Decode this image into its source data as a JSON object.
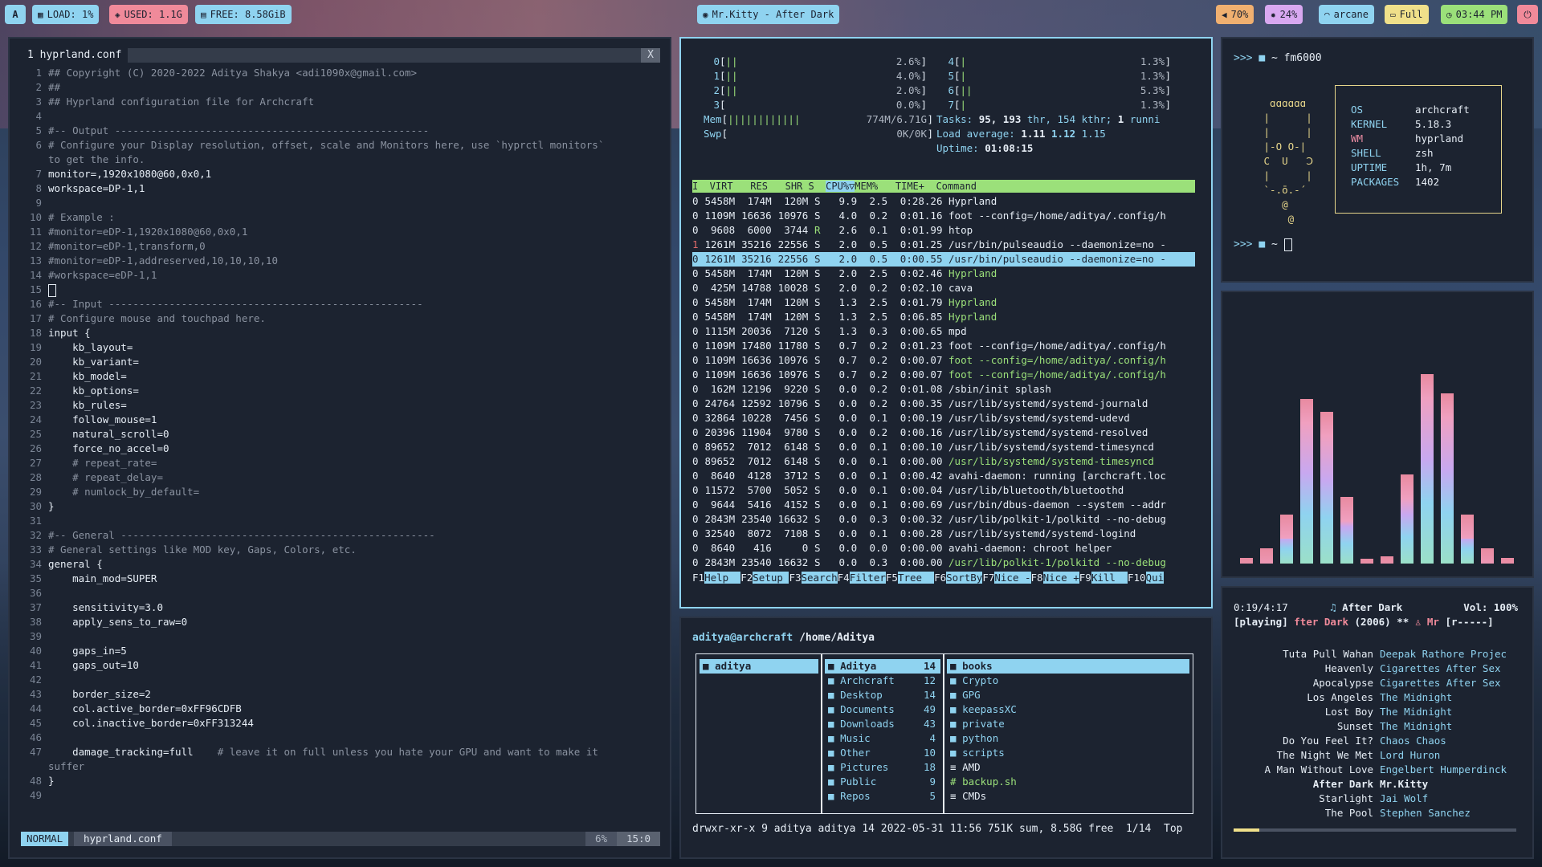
{
  "topbar": {
    "logo": "A",
    "load": "LOAD: 1%",
    "used": "USED: 1.1G",
    "free": "FREE: 8.58GiB",
    "window_title": "Mr.Kitty - After Dark",
    "volume": "70%",
    "brightness": "24%",
    "wifi": "arcane",
    "battery": "Full",
    "clock": "03:44 PM",
    "colors": {
      "load": "#8fd3f0",
      "used": "#f08a9a",
      "free": "#8fd3f0",
      "title": "#8fd3f0",
      "volume": "#f0b070",
      "brightness": "#d8a8f0",
      "wifi": "#8fd3f0",
      "battery": "#f0e08a",
      "clock": "#9be07a",
      "power": "#f08a9a"
    }
  },
  "editor": {
    "tab_title": "1 hyprland.conf",
    "tab_close": "X",
    "lines": [
      {
        "n": "1",
        "t": "## Copyright (C) 2020-2022 Aditya Shakya <adi1090x@gmail.com>",
        "c": true
      },
      {
        "n": "2",
        "t": "##",
        "c": true
      },
      {
        "n": "3",
        "t": "## Hyprland configuration file for Archcraft",
        "c": true
      },
      {
        "n": "4",
        "t": "",
        "c": false
      },
      {
        "n": "5",
        "t": "#-- Output ----------------------------------------------------",
        "c": true
      },
      {
        "n": "6",
        "t": "# Configure your Display resolution, offset, scale and Monitors here, use `hyprctl monitors`",
        "c": true
      },
      {
        "n": "",
        "t": "to get the info.",
        "c": true,
        "wrap": true
      },
      {
        "n": "7",
        "t": "monitor=,1920x1080@60,0x0,1",
        "c": false
      },
      {
        "n": "8",
        "t": "workspace=DP-1,1",
        "c": false
      },
      {
        "n": "9",
        "t": "",
        "c": false
      },
      {
        "n": "10",
        "t": "# Example :",
        "c": true
      },
      {
        "n": "11",
        "t": "#monitor=eDP-1,1920x1080@60,0x0,1",
        "c": true
      },
      {
        "n": "12",
        "t": "#monitor=eDP-1,transform,0",
        "c": true
      },
      {
        "n": "13",
        "t": "#monitor=eDP-1,addreserved,10,10,10,10",
        "c": true
      },
      {
        "n": "14",
        "t": "#workspace=eDP-1,1",
        "c": true
      },
      {
        "n": "15",
        "t": "",
        "c": false,
        "cursor": true
      },
      {
        "n": "16",
        "t": "#-- Input ----------------------------------------------------",
        "c": true
      },
      {
        "n": "17",
        "t": "# Configure mouse and touchpad here.",
        "c": true
      },
      {
        "n": "18",
        "t": "input {",
        "c": false
      },
      {
        "n": "19",
        "t": "    kb_layout=",
        "c": false
      },
      {
        "n": "20",
        "t": "    kb_variant=",
        "c": false
      },
      {
        "n": "21",
        "t": "    kb_model=",
        "c": false
      },
      {
        "n": "22",
        "t": "    kb_options=",
        "c": false
      },
      {
        "n": "23",
        "t": "    kb_rules=",
        "c": false
      },
      {
        "n": "24",
        "t": "    follow_mouse=1",
        "c": false
      },
      {
        "n": "25",
        "t": "    natural_scroll=0",
        "c": false
      },
      {
        "n": "26",
        "t": "    force_no_accel=0",
        "c": false
      },
      {
        "n": "27",
        "t": "    # repeat_rate=",
        "c": true
      },
      {
        "n": "28",
        "t": "    # repeat_delay=",
        "c": true
      },
      {
        "n": "29",
        "t": "    # numlock_by_default=",
        "c": true
      },
      {
        "n": "30",
        "t": "}",
        "c": false
      },
      {
        "n": "31",
        "t": "",
        "c": false
      },
      {
        "n": "32",
        "t": "#-- General ----------------------------------------------------",
        "c": true
      },
      {
        "n": "33",
        "t": "# General settings like MOD key, Gaps, Colors, etc.",
        "c": true
      },
      {
        "n": "34",
        "t": "general {",
        "c": false
      },
      {
        "n": "35",
        "t": "    main_mod=SUPER",
        "c": false
      },
      {
        "n": "36",
        "t": "",
        "c": false
      },
      {
        "n": "37",
        "t": "    sensitivity=3.0",
        "c": false
      },
      {
        "n": "38",
        "t": "    apply_sens_to_raw=0",
        "c": false
      },
      {
        "n": "39",
        "t": "",
        "c": false
      },
      {
        "n": "40",
        "t": "    gaps_in=5",
        "c": false
      },
      {
        "n": "41",
        "t": "    gaps_out=10",
        "c": false
      },
      {
        "n": "42",
        "t": "",
        "c": false
      },
      {
        "n": "43",
        "t": "    border_size=2",
        "c": false
      },
      {
        "n": "44",
        "t": "    col.active_border=0xFF96CDFB",
        "c": false
      },
      {
        "n": "45",
        "t": "    col.inactive_border=0xFF313244",
        "c": false
      },
      {
        "n": "46",
        "t": "",
        "c": false
      },
      {
        "n": "47",
        "t": "    damage_tracking=full",
        "c": false,
        "trail": "    # leave it on full unless you hate your GPU and want to make it"
      },
      {
        "n": "",
        "t": "suffer",
        "c": true,
        "wrap": true
      },
      {
        "n": "48",
        "t": "}",
        "c": false
      },
      {
        "n": "49",
        "t": "",
        "c": false
      }
    ],
    "status": {
      "mode": "NORMAL",
      "file": "hyprland.conf",
      "percent": "6%",
      "position": "15:0"
    }
  },
  "htop": {
    "cpus": [
      {
        "id": "0",
        "bar": "||",
        "pct": "2.6%"
      },
      {
        "id": "1",
        "bar": "||",
        "pct": "4.0%"
      },
      {
        "id": "2",
        "bar": "||",
        "pct": "2.0%"
      },
      {
        "id": "3",
        "bar": "",
        "pct": "0.0%"
      },
      {
        "id": "4",
        "bar": "|",
        "pct": "1.3%"
      },
      {
        "id": "5",
        "bar": "|",
        "pct": "1.3%"
      },
      {
        "id": "6",
        "bar": "||",
        "pct": "5.3%"
      },
      {
        "id": "7",
        "bar": "|",
        "pct": "1.3%"
      }
    ],
    "mem": {
      "label": "Mem",
      "bar": "||||||||||||",
      "value": "774M/6.71G"
    },
    "swp": {
      "label": "Swp",
      "value": "0K/0K"
    },
    "tasks": {
      "label": "Tasks:",
      "tasks": "95,",
      "thr": "193",
      "thr_label": "thr, 154 kthr;",
      "running": "1",
      "running_label": "runni"
    },
    "load": {
      "label": "Load average:",
      "a": "1.11",
      "b": "1.12",
      "c": "1.15"
    },
    "uptime": {
      "label": "Uptime:",
      "value": "01:08:15"
    },
    "header": {
      "pre": "I  VIRT   RES   SHR S  ",
      "sort": "CPU%▽",
      "post": "MEM%   TIME+  Command"
    },
    "processes": [
      {
        "p": "0",
        "virt": "5458M",
        "res": "174M",
        "shr": "120M",
        "s": "S",
        "cpu": "9.9",
        "mem": "2.5",
        "time": "0:28.26",
        "cmd": "Hyprland",
        "thr": false
      },
      {
        "p": "0",
        "virt": "1109M",
        "res": "16636",
        "shr": "10976",
        "s": "S",
        "cpu": "4.0",
        "mem": "0.2",
        "time": "0:01.16",
        "cmd": "foot --config=/home/aditya/.config/h",
        "thr": false
      },
      {
        "p": "0",
        "virt": "9608",
        "res": "6000",
        "shr": "3744",
        "s": "R",
        "cpu": "2.6",
        "mem": "0.1",
        "time": "0:01.99",
        "cmd": "htop",
        "thr": false
      },
      {
        "p": "1",
        "virt": "1261M",
        "res": "35216",
        "shr": "22556",
        "s": "S",
        "cpu": "2.0",
        "mem": "0.5",
        "time": "0:01.25",
        "cmd": "/usr/bin/pulseaudio --daemonize=no -",
        "thr": false,
        "red": true
      },
      {
        "p": "0",
        "virt": "1261M",
        "res": "35216",
        "shr": "22556",
        "s": "S",
        "cpu": "2.0",
        "mem": "0.5",
        "time": "0:00.55",
        "cmd": "/usr/bin/pulseaudio --daemonize=no -",
        "thr": false,
        "sel": true
      },
      {
        "p": "0",
        "virt": "5458M",
        "res": "174M",
        "shr": "120M",
        "s": "S",
        "cpu": "2.0",
        "mem": "2.5",
        "time": "0:02.46",
        "cmd": "Hyprland",
        "thr": true
      },
      {
        "p": "0",
        "virt": "425M",
        "res": "14788",
        "shr": "10028",
        "s": "S",
        "cpu": "2.0",
        "mem": "0.2",
        "time": "0:02.10",
        "cmd": "cava",
        "thr": false
      },
      {
        "p": "0",
        "virt": "5458M",
        "res": "174M",
        "shr": "120M",
        "s": "S",
        "cpu": "1.3",
        "mem": "2.5",
        "time": "0:01.79",
        "cmd": "Hyprland",
        "thr": true
      },
      {
        "p": "0",
        "virt": "5458M",
        "res": "174M",
        "shr": "120M",
        "s": "S",
        "cpu": "1.3",
        "mem": "2.5",
        "time": "0:06.85",
        "cmd": "Hyprland",
        "thr": true
      },
      {
        "p": "0",
        "virt": "1115M",
        "res": "20036",
        "shr": "7120",
        "s": "S",
        "cpu": "1.3",
        "mem": "0.3",
        "time": "0:00.65",
        "cmd": "mpd",
        "thr": false
      },
      {
        "p": "0",
        "virt": "1109M",
        "res": "17480",
        "shr": "11780",
        "s": "S",
        "cpu": "0.7",
        "mem": "0.2",
        "time": "0:01.23",
        "cmd": "foot --config=/home/aditya/.config/h",
        "thr": false
      },
      {
        "p": "0",
        "virt": "1109M",
        "res": "16636",
        "shr": "10976",
        "s": "S",
        "cpu": "0.7",
        "mem": "0.2",
        "time": "0:00.07",
        "cmd": "foot --config=/home/aditya/.config/h",
        "thr": true
      },
      {
        "p": "0",
        "virt": "1109M",
        "res": "16636",
        "shr": "10976",
        "s": "S",
        "cpu": "0.7",
        "mem": "0.2",
        "time": "0:00.07",
        "cmd": "foot --config=/home/aditya/.config/h",
        "thr": true
      },
      {
        "p": "0",
        "virt": "162M",
        "res": "12196",
        "shr": "9220",
        "s": "S",
        "cpu": "0.0",
        "mem": "0.2",
        "time": "0:01.08",
        "cmd": "/sbin/init splash",
        "thr": false
      },
      {
        "p": "0",
        "virt": "24764",
        "res": "12592",
        "shr": "10796",
        "s": "S",
        "cpu": "0.0",
        "mem": "0.2",
        "time": "0:00.35",
        "cmd": "/usr/lib/systemd/systemd-journald",
        "thr": false
      },
      {
        "p": "0",
        "virt": "32864",
        "res": "10228",
        "shr": "7456",
        "s": "S",
        "cpu": "0.0",
        "mem": "0.1",
        "time": "0:00.19",
        "cmd": "/usr/lib/systemd/systemd-udevd",
        "thr": false
      },
      {
        "p": "0",
        "virt": "20396",
        "res": "11904",
        "shr": "9780",
        "s": "S",
        "cpu": "0.0",
        "mem": "0.2",
        "time": "0:00.16",
        "cmd": "/usr/lib/systemd/systemd-resolved",
        "thr": false
      },
      {
        "p": "0",
        "virt": "89652",
        "res": "7012",
        "shr": "6148",
        "s": "S",
        "cpu": "0.0",
        "mem": "0.1",
        "time": "0:00.10",
        "cmd": "/usr/lib/systemd/systemd-timesyncd",
        "thr": false
      },
      {
        "p": "0",
        "virt": "89652",
        "res": "7012",
        "shr": "6148",
        "s": "S",
        "cpu": "0.0",
        "mem": "0.1",
        "time": "0:00.00",
        "cmd": "/usr/lib/systemd/systemd-timesyncd",
        "thr": true
      },
      {
        "p": "0",
        "virt": "8640",
        "res": "4128",
        "shr": "3712",
        "s": "S",
        "cpu": "0.0",
        "mem": "0.1",
        "time": "0:00.42",
        "cmd": "avahi-daemon: running [archcraft.loc",
        "thr": false
      },
      {
        "p": "0",
        "virt": "11572",
        "res": "5700",
        "shr": "5052",
        "s": "S",
        "cpu": "0.0",
        "mem": "0.1",
        "time": "0:00.04",
        "cmd": "/usr/lib/bluetooth/bluetoothd",
        "thr": false
      },
      {
        "p": "0",
        "virt": "9644",
        "res": "5416",
        "shr": "4152",
        "s": "S",
        "cpu": "0.0",
        "mem": "0.1",
        "time": "0:00.69",
        "cmd": "/usr/bin/dbus-daemon --system --addr",
        "thr": false
      },
      {
        "p": "0",
        "virt": "2843M",
        "res": "23540",
        "shr": "16632",
        "s": "S",
        "cpu": "0.0",
        "mem": "0.3",
        "time": "0:00.32",
        "cmd": "/usr/lib/polkit-1/polkitd --no-debug",
        "thr": false
      },
      {
        "p": "0",
        "virt": "32540",
        "res": "8072",
        "shr": "7108",
        "s": "S",
        "cpu": "0.0",
        "mem": "0.1",
        "time": "0:00.28",
        "cmd": "/usr/lib/systemd/systemd-logind",
        "thr": false
      },
      {
        "p": "0",
        "virt": "8640",
        "res": "416",
        "shr": "0",
        "s": "S",
        "cpu": "0.0",
        "mem": "0.0",
        "time": "0:00.00",
        "cmd": "avahi-daemon: chroot helper",
        "thr": false
      },
      {
        "p": "0",
        "virt": "2843M",
        "res": "23540",
        "shr": "16632",
        "s": "S",
        "cpu": "0.0",
        "mem": "0.3",
        "time": "0:00.00",
        "cmd": "/usr/lib/polkit-1/polkitd --no-debug",
        "thr": true
      }
    ],
    "fkeys": [
      {
        "k": "F1",
        "l": "Help  "
      },
      {
        "k": "F2",
        "l": "Setup "
      },
      {
        "k": "F3",
        "l": "Search"
      },
      {
        "k": "F4",
        "l": "Filter"
      },
      {
        "k": "F5",
        "l": "Tree  "
      },
      {
        "k": "F6",
        "l": "SortBy"
      },
      {
        "k": "F7",
        "l": "Nice -"
      },
      {
        "k": "F8",
        "l": "Nice +"
      },
      {
        "k": "F9",
        "l": "Kill  "
      },
      {
        "k": "F10",
        "l": "Qui"
      }
    ]
  },
  "fetch": {
    "prompt1": ">>> ",
    "dir1": "~ fm6000",
    "prompt2": ">>> ",
    "dir2": "~",
    "rows": [
      {
        "k": "OS",
        "v": "archcraft",
        "pink": false
      },
      {
        "k": "KERNEL",
        "v": "5.18.3",
        "pink": false
      },
      {
        "k": "WM",
        "v": "hyprland",
        "pink": true
      },
      {
        "k": "SHELL",
        "v": "zsh",
        "pink": false
      },
      {
        "k": "UPTIME",
        "v": "1h, 7m",
        "pink": false
      },
      {
        "k": "PACKAGES",
        "v": "1402",
        "pink": false
      }
    ],
    "art": [
      "  ɑɑɑɑɑɑ",
      " |      |",
      " |      |",
      " |-O O-|",
      " C  U   Ↄ",
      " |      |",
      " `-.ō.-´",
      "    @",
      "     @"
    ]
  },
  "visualizer": {
    "levels": [
      0.03,
      0.08,
      0.26,
      0.87,
      0.8,
      0.35,
      0.02,
      0.04,
      0.47,
      1.0,
      0.9,
      0.26,
      0.08,
      0.03
    ]
  },
  "mpd": {
    "time": "0:19/4:17",
    "note": "♫",
    "song": "After Dark",
    "volume": "Vol: 100%",
    "state": "[playing]",
    "scroll_title": "fter Dark",
    "year": "(2006)",
    "stars": "**",
    "artist_short": "Mr",
    "flags": "[r-----]",
    "progress": 0.09,
    "playlist": [
      {
        "title": "Tuta Pull Wahan",
        "artist": "Deepak Rathore Projec"
      },
      {
        "title": "Heavenly",
        "artist": "Cigarettes After Sex"
      },
      {
        "title": "Apocalypse",
        "artist": "Cigarettes After Sex"
      },
      {
        "title": "Los Angeles",
        "artist": "The Midnight"
      },
      {
        "title": "Lost Boy",
        "artist": "The Midnight"
      },
      {
        "title": "Sunset",
        "artist": "The Midnight"
      },
      {
        "title": "Do You Feel It?",
        "artist": "Chaos Chaos"
      },
      {
        "title": "The Night We Met",
        "artist": "Lord Huron"
      },
      {
        "title": "A Man Without Love",
        "artist": "Engelbert Humperdinck"
      },
      {
        "title": "After Dark",
        "artist": "Mr.Kitty",
        "current": true
      },
      {
        "title": "Starlight",
        "artist": "Jai Wolf"
      },
      {
        "title": "The Pool",
        "artist": "Stephen Sanchez"
      }
    ]
  },
  "ranger": {
    "user_host": "aditya@archcraft",
    "path": "/home/Aditya",
    "parent": [
      {
        "name": "aditya",
        "sel": true
      }
    ],
    "current": [
      {
        "name": "Aditya",
        "count": "14",
        "sel": true
      },
      {
        "name": "Archcraft",
        "count": "12"
      },
      {
        "name": "Desktop",
        "count": "14"
      },
      {
        "name": "Documents",
        "count": "49"
      },
      {
        "name": "Downloads",
        "count": "43"
      },
      {
        "name": "Music",
        "count": "4"
      },
      {
        "name": "Other",
        "count": "10"
      },
      {
        "name": "Pictures",
        "count": "18"
      },
      {
        "name": "Public",
        "count": "9"
      },
      {
        "name": "Repos",
        "count": "5"
      }
    ],
    "preview": [
      {
        "name": "books",
        "type": "dir",
        "sel": true
      },
      {
        "name": "Crypto",
        "type": "dir"
      },
      {
        "name": "GPG",
        "type": "dir"
      },
      {
        "name": "keepassXC",
        "type": "dir"
      },
      {
        "name": "private",
        "type": "dir"
      },
      {
        "name": "python",
        "type": "dir"
      },
      {
        "name": "scripts",
        "type": "dir"
      },
      {
        "name": "AMD",
        "type": "file"
      },
      {
        "name": "backup.sh",
        "type": "exe"
      },
      {
        "name": "CMDs",
        "type": "file"
      }
    ],
    "status": "drwxr-xr-x 9 aditya aditya 14 2022-05-31 11:56 751K sum, 8.58G free  1/14  Top"
  }
}
